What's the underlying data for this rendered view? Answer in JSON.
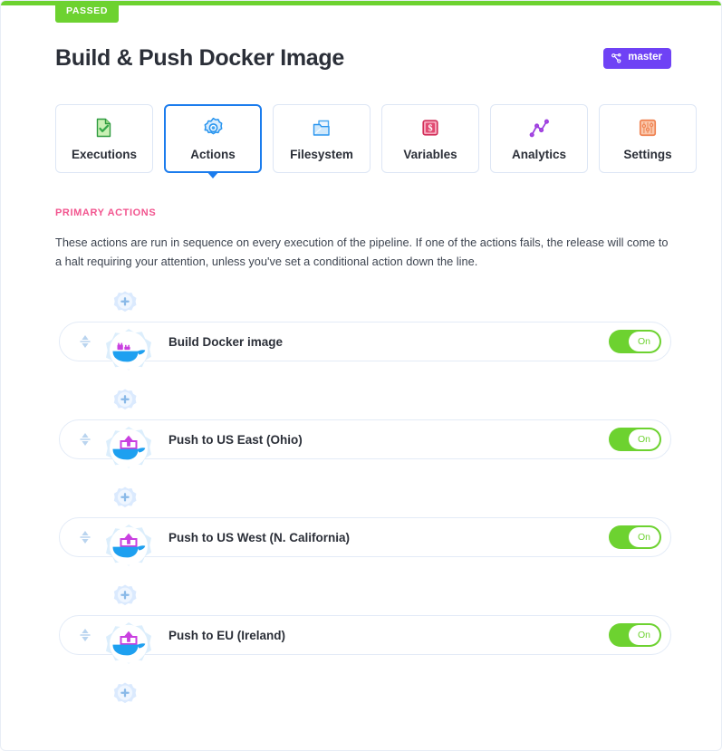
{
  "status": {
    "label": "PASSED",
    "color": "#6dd230"
  },
  "header": {
    "title": "Build & Push Docker Image",
    "branch": {
      "label": "master",
      "icon": "git-branch-icon",
      "color": "#6f42f5"
    }
  },
  "tabs": [
    {
      "label": "Executions",
      "icon": "document-check-icon",
      "active": false
    },
    {
      "label": "Actions",
      "icon": "gear-icon",
      "active": true
    },
    {
      "label": "Filesystem",
      "icon": "folder-icon",
      "active": false
    },
    {
      "label": "Variables",
      "icon": "dollar-card-icon",
      "active": false
    },
    {
      "label": "Analytics",
      "icon": "line-chart-icon",
      "active": false
    },
    {
      "label": "Settings",
      "icon": "sliders-icon",
      "active": false
    }
  ],
  "section": {
    "title": "PRIMARY ACTIONS",
    "title_color": "#f2558f",
    "description": "These actions are run in sequence on every execution of the pipeline. If one of the actions fails, the release will come to a halt requiring your attention, unless you've set a conditional action down the line."
  },
  "actions": [
    {
      "label": "Build Docker image",
      "icon": "docker-build-icon",
      "toggle": {
        "state": "On",
        "enabled": true,
        "color": "#6dd230"
      }
    },
    {
      "label": "Push to US East (Ohio)",
      "icon": "docker-push-icon",
      "toggle": {
        "state": "On",
        "enabled": true,
        "color": "#6dd230"
      }
    },
    {
      "label": "Push to US West (N. California)",
      "icon": "docker-push-icon",
      "toggle": {
        "state": "On",
        "enabled": true,
        "color": "#6dd230"
      }
    },
    {
      "label": "Push to EU (Ireland)",
      "icon": "docker-push-icon",
      "toggle": {
        "state": "On",
        "enabled": true,
        "color": "#6dd230"
      }
    }
  ],
  "connectors": {
    "icon": "add-action-icon",
    "count": 5
  }
}
